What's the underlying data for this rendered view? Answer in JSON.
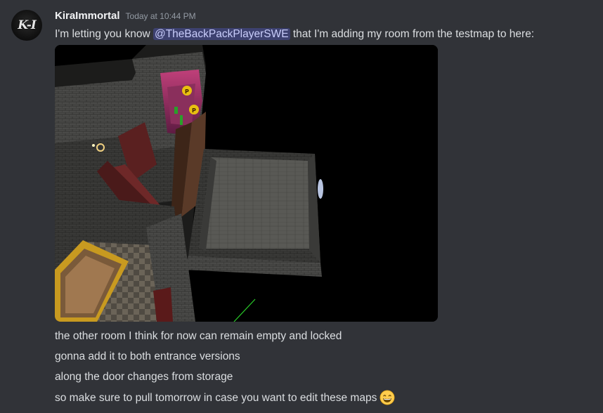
{
  "message": {
    "author": {
      "username": "KiraImmortal",
      "avatar_text": "K-I"
    },
    "timestamp": "Today at 10:44 PM",
    "content_line1": {
      "before": "I'm letting you know ",
      "mention": "@TheBackPackPlayerSWE",
      "after": " that I'm adding my room from the testmap to here:"
    },
    "attachment": {
      "type": "image",
      "icon": "game-screenshot"
    },
    "followups": [
      "the other room I think for now can remain empty and locked",
      "gonna add it to both entrance versions",
      "along the door changes from storage",
      "so make sure to pull tomorrow in case you want to edit these maps"
    ],
    "emoji": "grinning-face-with-smiling-eyes"
  },
  "colors": {
    "background": "#313338",
    "text": "#dbdee1",
    "username": "#f2f3f5",
    "timestamp": "#949ba4",
    "mention_bg": "#3c4270",
    "mention_text": "#c9cdfb"
  }
}
